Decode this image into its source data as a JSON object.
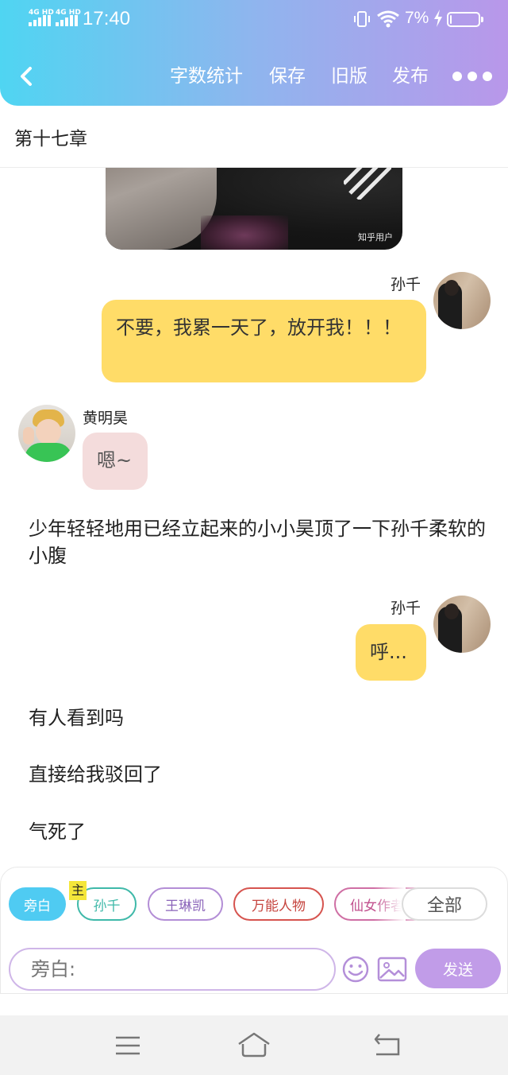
{
  "status_bar": {
    "network_1": "4G HD",
    "network_2": "4G HD",
    "time": "17:40",
    "battery_percent": "7%",
    "battery_level": 0.07,
    "icons": [
      "signal-icon",
      "vibrate-icon",
      "wifi-icon",
      "charging-icon",
      "battery-icon"
    ]
  },
  "header": {
    "back_icon": "chevron-left-icon",
    "actions": [
      "字数统计",
      "保存",
      "旧版",
      "发布"
    ],
    "more_icon": "more-dots-icon",
    "gradient": [
      "#4fd5f2",
      "#b997ea"
    ]
  },
  "chapter": {
    "title": "第十七章"
  },
  "photo": {
    "watermark": "知乎用户"
  },
  "messages": [
    {
      "speaker": "孙千",
      "side": "right",
      "text": "不要，我累一天了，放开我！！！",
      "color": "#ffdc68"
    },
    {
      "speaker": "黄明昊",
      "side": "left",
      "text": "嗯~",
      "color": "#f4dcdc"
    },
    {
      "type": "narration",
      "text": "少年轻轻地用已经立起来的小小昊顶了一下孙千柔软的小腹"
    },
    {
      "speaker": "孙千",
      "side": "right",
      "text": "呼...",
      "color": "#ffdc68"
    },
    {
      "type": "narration",
      "text": "有人看到吗"
    },
    {
      "type": "narration",
      "text": "直接给我驳回了"
    },
    {
      "type": "narration",
      "text": "气死了"
    }
  ],
  "role_chips": {
    "items": [
      "旁白",
      "孙千",
      "王琳凯",
      "万能人物",
      "仙女作者"
    ],
    "main_badge": "主",
    "all_label": "全部",
    "selected": "旁白"
  },
  "composer": {
    "placeholder": "旁白:",
    "emoji_icon": "emoji-icon",
    "image_icon": "image-icon",
    "send_label": "发送",
    "accent": "#c19ce8"
  },
  "system_nav": {
    "icons": [
      "menu-icon",
      "home-icon",
      "back-icon"
    ]
  }
}
